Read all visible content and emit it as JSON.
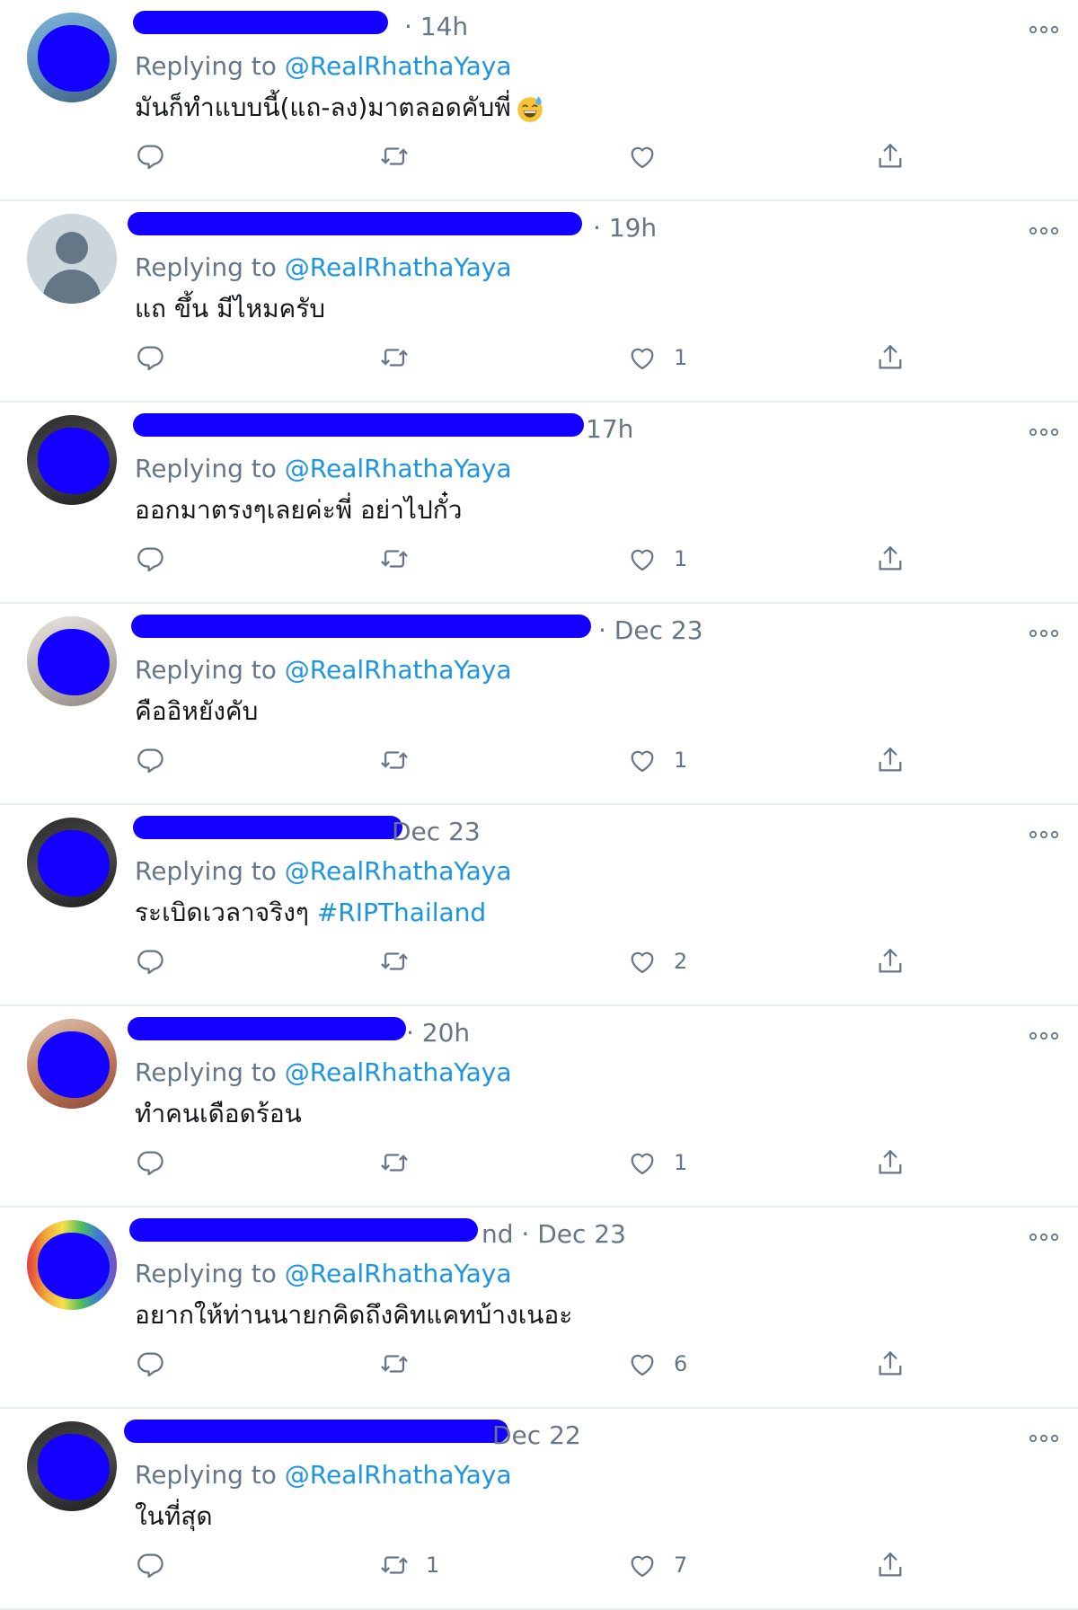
{
  "feed": {
    "tweets": [
      {
        "time": "· 14h",
        "reply_prefix": "Replying to",
        "reply_handle": "@RealRhathaYaya",
        "text": "มันก็ทำแบบนี้(แถ-ลง)มาตลอดคับพี่",
        "hashtag": "",
        "has_emoji": true,
        "retweet_count": "",
        "like_count": "",
        "avatar": "photo-blue"
      },
      {
        "time": "· 19h",
        "reply_prefix": "Replying to",
        "reply_handle": "@RealRhathaYaya",
        "text": "แถ ขึ้น มีไหมครับ",
        "hashtag": "",
        "has_emoji": false,
        "retweet_count": "",
        "like_count": "1",
        "avatar": "default"
      },
      {
        "time": "17h",
        "reply_prefix": "Replying to",
        "reply_handle": "@RealRhathaYaya",
        "text": "ออกมาตรงๆเลยค่ะพี่ อย่าไปกั๋ว",
        "hashtag": "",
        "has_emoji": false,
        "retweet_count": "",
        "like_count": "1",
        "avatar": "photo-dark"
      },
      {
        "time": "· Dec 23",
        "reply_prefix": "Replying to",
        "reply_handle": "@RealRhathaYaya",
        "text": "คืออิหยังคับ",
        "hashtag": "",
        "has_emoji": false,
        "retweet_count": "",
        "like_count": "1",
        "avatar": "photo-light"
      },
      {
        "time": "Dec 23",
        "reply_prefix": "Replying to",
        "reply_handle": "@RealRhathaYaya",
        "text": "ระเบิดเวลาจริงๆ",
        "hashtag": "#RIPThailand",
        "has_emoji": false,
        "retweet_count": "",
        "like_count": "2",
        "avatar": "photo-dark"
      },
      {
        "time": "· 20h",
        "reply_prefix": "Replying to",
        "reply_handle": "@RealRhathaYaya",
        "text": "ทำคนเดือดร้อน",
        "hashtag": "",
        "has_emoji": false,
        "retweet_count": "",
        "like_count": "1",
        "avatar": "photo-warm"
      },
      {
        "time": "nd · Dec 23",
        "reply_prefix": "Replying to",
        "reply_handle": "@RealRhathaYaya",
        "text": "อยากให้ท่านนายกคิดถึงคิทแคทบ้างเนอะ",
        "hashtag": "",
        "has_emoji": false,
        "retweet_count": "",
        "like_count": "6",
        "avatar": "photo-rainbow"
      },
      {
        "time": "Dec 22",
        "reply_prefix": "Replying to",
        "reply_handle": "@RealRhathaYaya",
        "text": "ในที่สุด",
        "hashtag": "",
        "has_emoji": false,
        "retweet_count": "1",
        "like_count": "7",
        "avatar": "photo-dark"
      }
    ]
  },
  "icons": {
    "reply": "reply-icon",
    "retweet": "retweet-icon",
    "like": "like-icon",
    "share": "share-icon",
    "more": "more-icon"
  },
  "colors": {
    "text": "#14171a",
    "muted": "#657786",
    "link": "#1b95e0",
    "redaction": "#1400ff",
    "divider": "#e6ecf0"
  }
}
